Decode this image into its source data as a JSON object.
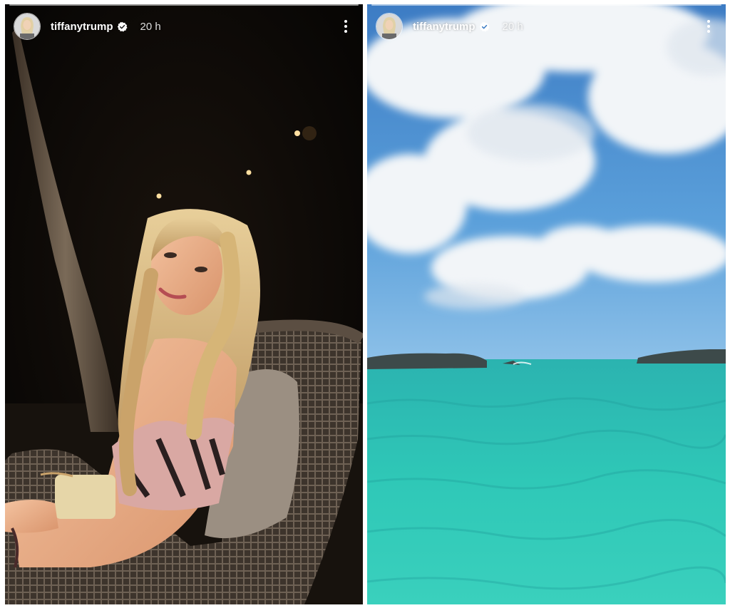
{
  "stories": [
    {
      "username": "tiffanytrump",
      "timestamp": "20 h",
      "verified": true,
      "media": "night-portrait-photo"
    },
    {
      "username": "tiffanytrump",
      "timestamp": "20 h",
      "verified": true,
      "media": "ocean-sky-photo"
    }
  ],
  "icons": {
    "verified": "verified-badge-icon",
    "more": "more-options-icon"
  },
  "colors": {
    "sea": "#2cc9b6",
    "sky": "#4f8fd0",
    "night": "#0b0806",
    "verified_badge": "#ffffff"
  }
}
